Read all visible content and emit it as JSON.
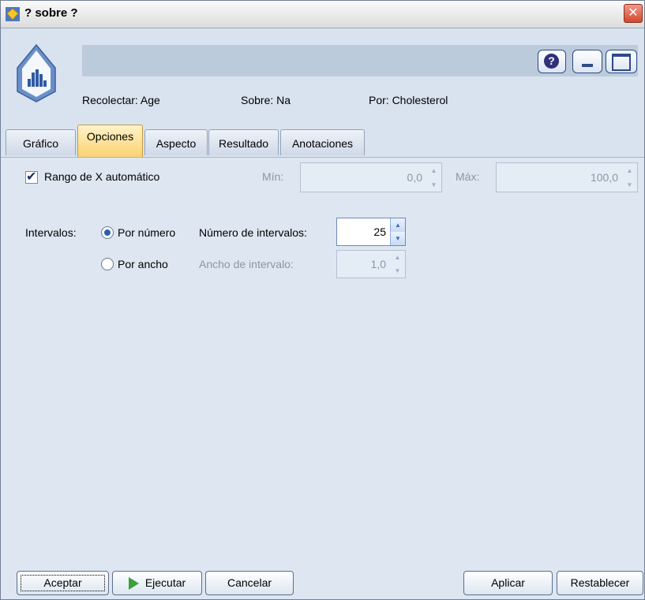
{
  "window": {
    "title": "? sobre ?",
    "close_label": "✕"
  },
  "header": {
    "help_label": "?",
    "collect_label": "Recolectar: Age",
    "over_label": "Sobre: Na",
    "by_label": "Por: Cholesterol"
  },
  "tabs": [
    {
      "label": "Gráfico"
    },
    {
      "label": "Opciones"
    },
    {
      "label": "Aspecto"
    },
    {
      "label": "Resultado"
    },
    {
      "label": "Anotaciones"
    }
  ],
  "active_tab": "Opciones",
  "options": {
    "auto_x_range": {
      "label": "Rango de X automático",
      "checked": true
    },
    "min": {
      "label": "Mín:",
      "value": "0,0"
    },
    "max": {
      "label": "Máx:",
      "value": "100,0"
    },
    "intervals_label": "Intervalos:",
    "by_number_label": "Por número",
    "by_width_label": "Por ancho",
    "mode_selected": "Por número",
    "num_intervals": {
      "label": "Número de intervalos:",
      "value": "25"
    },
    "interval_width": {
      "label": "Ancho de intervalo:",
      "value": "1,0"
    }
  },
  "footer": {
    "ok": "Aceptar",
    "run": "Ejecutar",
    "cancel": "Cancelar",
    "apply": "Aplicar",
    "reset": "Restablecer"
  },
  "colors": {
    "active_tab": "#fbd271",
    "background": "#dde6f1",
    "run_icon": "#3ca13c"
  }
}
